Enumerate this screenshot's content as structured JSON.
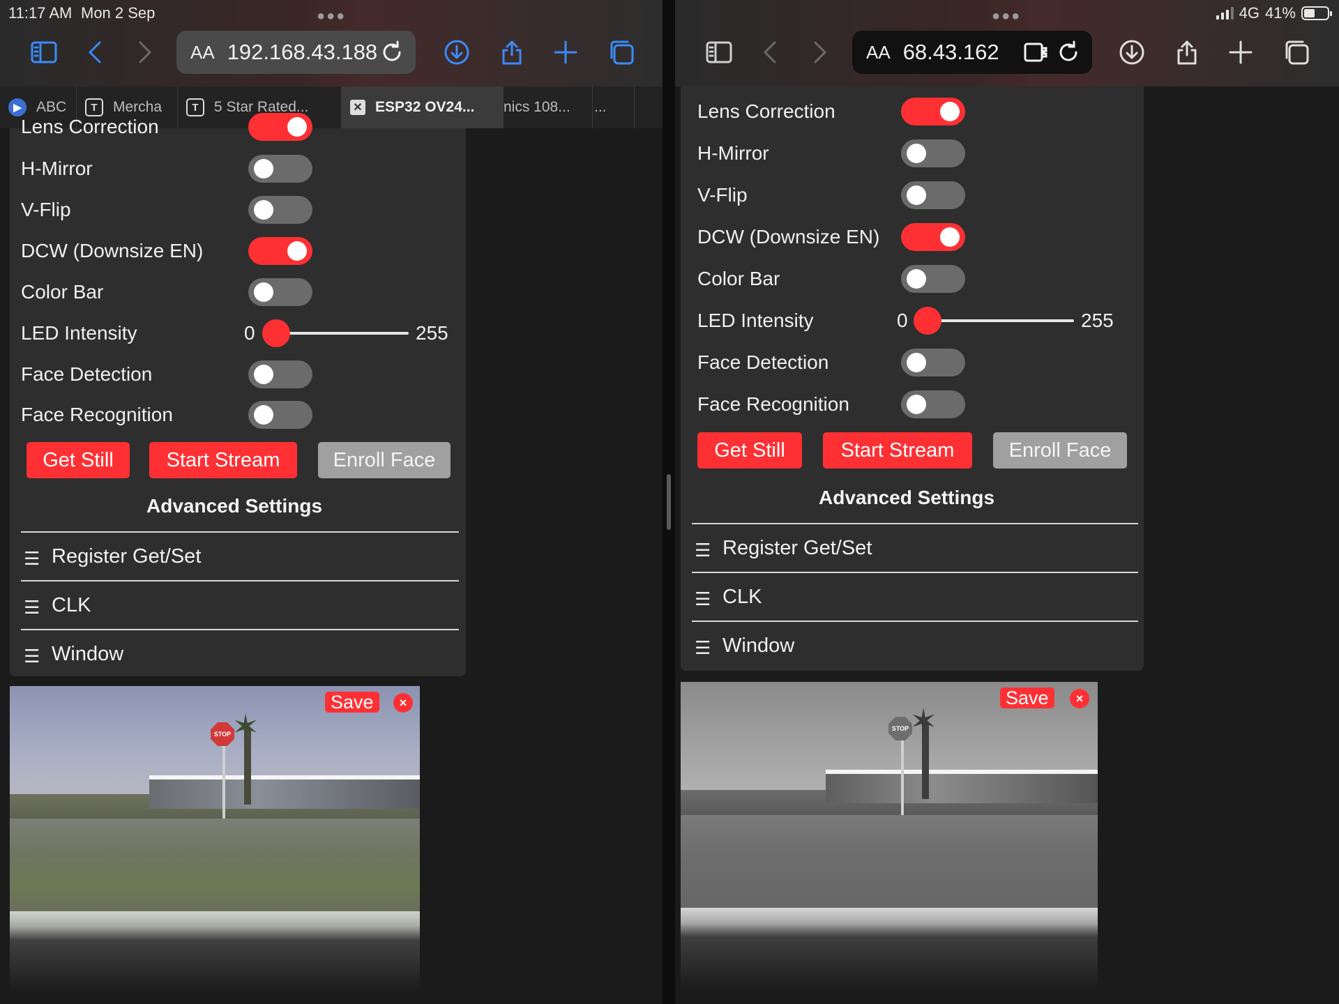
{
  "status_bar": {
    "time": "11:17 AM",
    "date": "Mon 2 Sep",
    "network": "4G",
    "battery": "41%"
  },
  "left": {
    "url": "192.168.43.188",
    "aa_label": "AA",
    "tabs": [
      {
        "label": "ABC",
        "icon": "round-play-icon"
      },
      {
        "label": "Mercha",
        "icon": "T"
      },
      {
        "label": "5 Star Rated...",
        "icon": "T"
      },
      {
        "label": "ESP32 OV24...",
        "icon": "x"
      },
      {
        "label": "nics 108..."
      },
      {
        "label": "..."
      }
    ],
    "settings": [
      {
        "label": "Lens Correction",
        "on": true
      },
      {
        "label": "H-Mirror",
        "on": false
      },
      {
        "label": "V-Flip",
        "on": false
      },
      {
        "label": "DCW (Downsize EN)",
        "on": true
      },
      {
        "label": "Color Bar",
        "on": false
      }
    ],
    "led": {
      "label": "LED Intensity",
      "min": "0",
      "max": "255",
      "value": 0
    },
    "settings2": [
      {
        "label": "Face Detection",
        "on": false
      },
      {
        "label": "Face Recognition",
        "on": false
      }
    ],
    "buttons": {
      "get_still": "Get Still",
      "start_stream": "Start Stream",
      "enroll_face": "Enroll Face"
    },
    "advanced_title": "Advanced Settings",
    "accordion": [
      "Register Get/Set",
      "CLK",
      "Window"
    ],
    "save_label": "Save",
    "close_label": "×",
    "stop_sign": "STOP"
  },
  "right": {
    "url": "68.43.162",
    "aa_label": "AA",
    "settings": [
      {
        "label": "Lens Correction",
        "on": true
      },
      {
        "label": "H-Mirror",
        "on": false
      },
      {
        "label": "V-Flip",
        "on": false
      },
      {
        "label": "DCW (Downsize EN)",
        "on": true
      },
      {
        "label": "Color Bar",
        "on": false
      }
    ],
    "led": {
      "label": "LED Intensity",
      "min": "0",
      "max": "255",
      "value": 0
    },
    "settings2": [
      {
        "label": "Face Detection",
        "on": false
      },
      {
        "label": "Face Recognition",
        "on": false
      }
    ],
    "buttons": {
      "get_still": "Get Still",
      "start_stream": "Start Stream",
      "enroll_face": "Enroll Face"
    },
    "advanced_title": "Advanced Settings",
    "accordion": [
      "Register Get/Set",
      "CLK",
      "Window"
    ],
    "save_label": "Save",
    "close_label": "×",
    "stop_sign": "STOP"
  },
  "colors": {
    "accent": "#ff3034",
    "switch_off": "#6b6b6b",
    "link_blue": "#3b8bff",
    "panel": "#2e2e2e"
  }
}
